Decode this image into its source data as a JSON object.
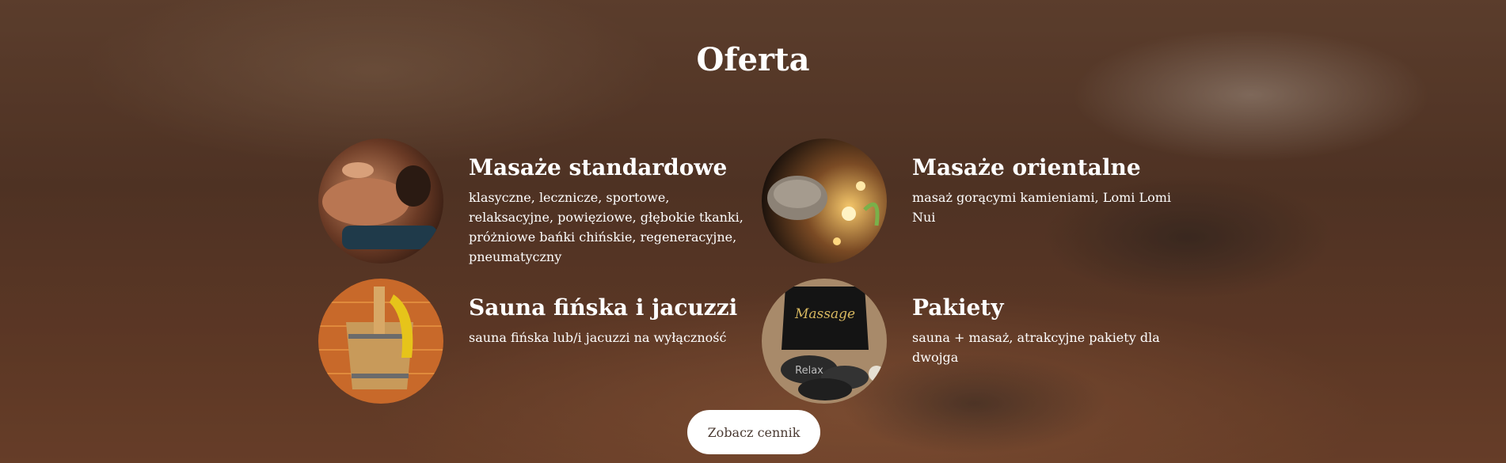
{
  "section": {
    "title": "Oferta"
  },
  "offers": [
    {
      "title": "Masaże standardowe",
      "description": "klasyczne, lecznicze, sportowe, relaksacyjne, powięziowe, głębokie tkanki, próżniowe bańki chińskie, regeneracyjne, pneumatyczny",
      "image_icon": "massage-photo-icon"
    },
    {
      "title": "Masaże orientalne",
      "description": "masaż gorącymi kamieniami, Lomi Lomi Nui",
      "image_icon": "candles-towels-photo-icon"
    },
    {
      "title": "Sauna fińska i jacuzzi",
      "description": "sauna fińska lub/i jacuzzi na wyłączność",
      "image_icon": "sauna-bucket-photo-icon"
    },
    {
      "title": "Pakiety",
      "description": "sauna + masaż, atrakcyjne pakiety dla dwojga",
      "image_icon": "relax-stones-photo-icon",
      "image_text": {
        "bag": "Massage",
        "stone": "Relax"
      }
    }
  ],
  "cta": {
    "label": "Zobacz cennik"
  }
}
